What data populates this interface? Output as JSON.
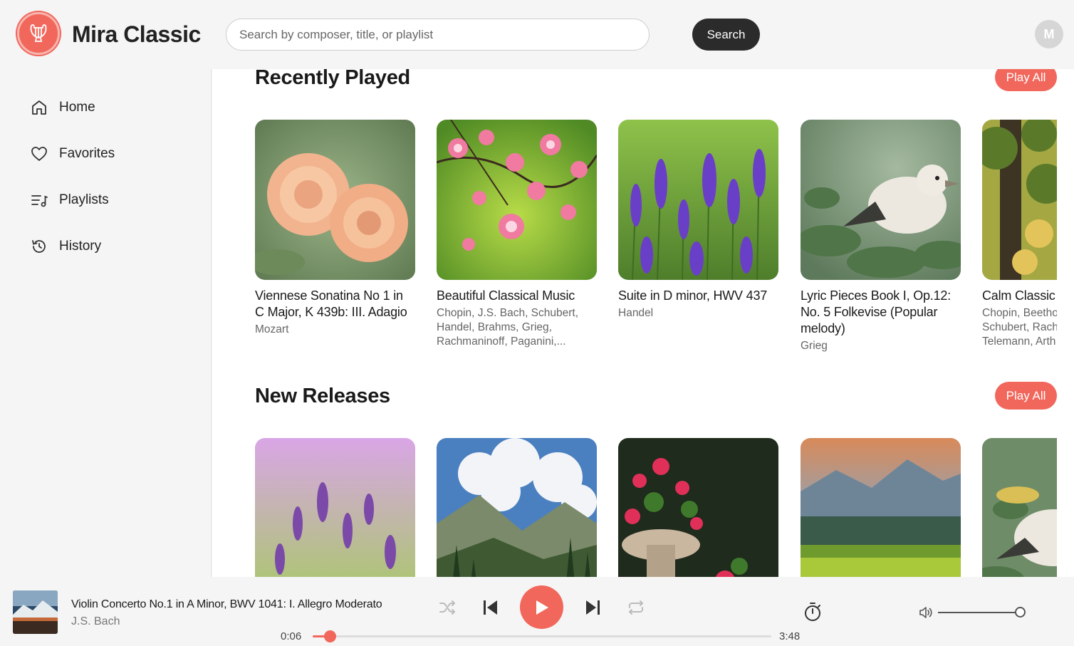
{
  "app": {
    "title": "Mira Classic",
    "avatar_initial": "M"
  },
  "search": {
    "placeholder": "Search by composer, title, or playlist",
    "button_label": "Search"
  },
  "sidebar": {
    "items": [
      {
        "label": "Home",
        "icon": "home-icon"
      },
      {
        "label": "Favorites",
        "icon": "heart-icon"
      },
      {
        "label": "Playlists",
        "icon": "playlist-icon"
      },
      {
        "label": "History",
        "icon": "history-icon"
      }
    ]
  },
  "sections": {
    "recent": {
      "title": "Recently Played",
      "play_all": "Play All",
      "cards": [
        {
          "title": "Viennese Sonatina No 1 in C Major, K 439b: III. Adagio",
          "subtitle": "Mozart",
          "image": "peach roses"
        },
        {
          "title": "Beautiful Classical Music",
          "subtitle": "Chopin, J.S. Bach, Schubert, Handel, Brahms, Grieg, Rachmaninoff, Paganini,...",
          "image": "pink blossoms"
        },
        {
          "title": "Suite in D minor, HWV 437",
          "subtitle": "Handel",
          "image": "lavender field"
        },
        {
          "title": "Lyric Pieces Book I, Op.12: No. 5 Folkevise (Popular melody)",
          "subtitle": "Grieg",
          "image": "white bird"
        },
        {
          "title": "Calm Classic",
          "subtitle": "Chopin, Beetho Schubert, Rach Telemann, Arth",
          "image": "forest tree"
        }
      ]
    },
    "new": {
      "title": "New Releases",
      "play_all": "Play All",
      "images": [
        "purple flowers",
        "mountain clouds",
        "flower urn",
        "mountain village",
        "white bird"
      ]
    }
  },
  "player": {
    "track_title": "Violin Concerto No.1 in A Minor, BWV 1041: I. Allegro Moderato",
    "artist": "J.S. Bach",
    "elapsed": "0:06",
    "duration": "3:48",
    "progress_fraction": 0.038,
    "volume_fraction": 1.0
  },
  "colors": {
    "accent": "#f2675c",
    "dark_button": "#2b2b2b",
    "background": "#f5f5f5"
  }
}
